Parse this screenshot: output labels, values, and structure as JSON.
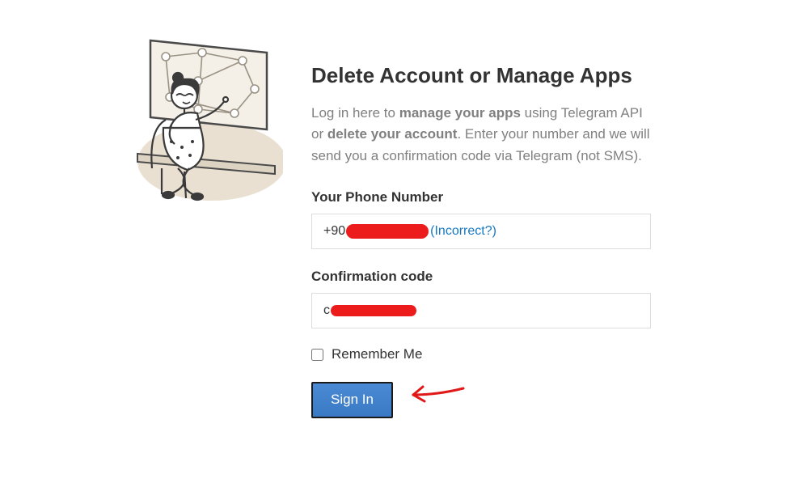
{
  "title": "Delete Account or Manage Apps",
  "description": {
    "part1": "Log in here to ",
    "bold1": "manage your apps",
    "part2": " using Telegram API or ",
    "bold2": "delete your account",
    "part3": ". Enter your number and we will send you a confirmation code via Telegram (not SMS)."
  },
  "phone": {
    "label": "Your Phone Number",
    "prefix_visible": "+90",
    "incorrect_link": "(Incorrect?)"
  },
  "code": {
    "label": "Confirmation code",
    "prefix_visible": "c"
  },
  "remember": {
    "label": "Remember Me",
    "checked": false
  },
  "signin": {
    "label": "Sign In"
  }
}
